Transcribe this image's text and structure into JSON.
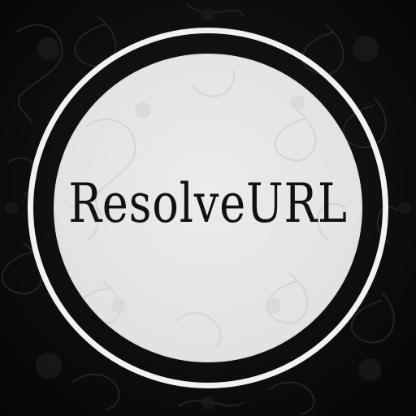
{
  "logo": {
    "wordmark": "ResolveURL"
  },
  "colors": {
    "background": "#0b0b0b",
    "ring": "#f2f2f2",
    "disc": "#e6e6e6",
    "text": "#111111"
  }
}
